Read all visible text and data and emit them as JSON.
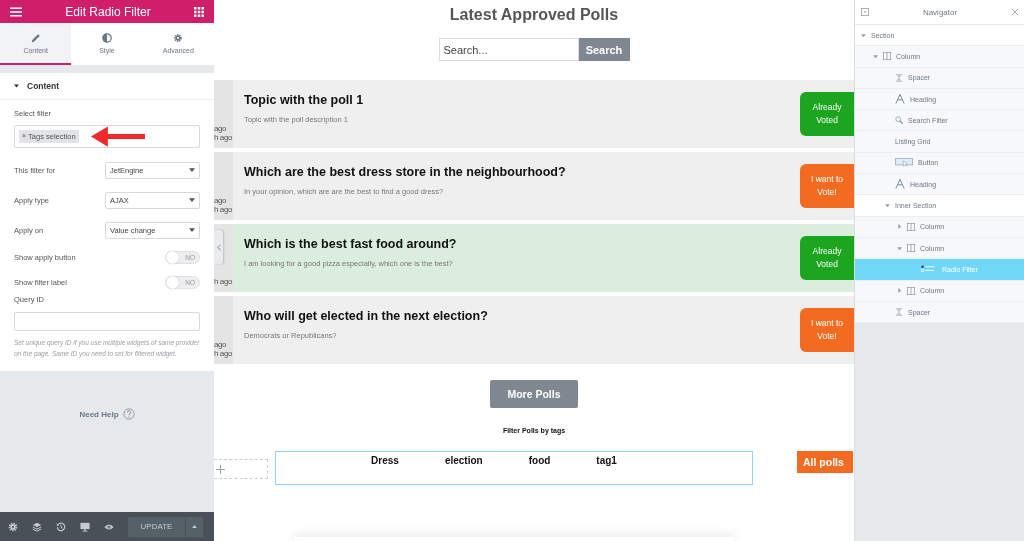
{
  "editor": {
    "title": "Edit Radio Filter",
    "tabs": [
      {
        "label": "Content",
        "selected": true
      },
      {
        "label": "Style",
        "selected": false
      },
      {
        "label": "Advanced",
        "selected": false
      }
    ],
    "section": {
      "title": "Content",
      "expanded": true
    },
    "select_filter": {
      "label": "Select filter",
      "tags": [
        {
          "remove": "×",
          "label": "Tags selection"
        }
      ]
    },
    "selects": [
      {
        "label": "This filter for",
        "value": "JetEngine"
      },
      {
        "label": "Apply type",
        "value": "AJAX"
      },
      {
        "label": "Apply on",
        "value": "Value change"
      }
    ],
    "toggles": [
      {
        "label": "Show apply button",
        "state": "NO",
        "on": false
      },
      {
        "label": "Show filter label",
        "state": "NO",
        "on": false
      }
    ],
    "query_id": {
      "label": "Query ID"
    },
    "hint": "Set unique query ID if you use multiple widgets of same provider on the page. Same ID you need to set for filtered widget.",
    "help": "Need Help",
    "update_button": "UPDATE"
  },
  "canvas": {
    "title": "Latest Approved Polls",
    "search": {
      "placeholder": "Search...",
      "button": "Search"
    },
    "polls": [
      {
        "title": "Topic with the poll 1",
        "description": "Topic with the poll description 1",
        "voted": true,
        "highlighted": false,
        "button": "Already Voted",
        "strip": [
          "ago",
          "h ago"
        ]
      },
      {
        "title": "Which are the best dress store in the neighbourhood?",
        "description": "In your opinion, which are are the best to find a good dress?",
        "voted": false,
        "highlighted": false,
        "button": "I want to Vote!",
        "strip": [
          "ago",
          "h ago"
        ]
      },
      {
        "title": "Which is the best fast food around?",
        "description": "I am looking for a good pizza especially, which one is the best?",
        "voted": true,
        "highlighted": true,
        "button": "Already Voted",
        "strip": [
          "h ago"
        ]
      },
      {
        "title": "Who will get elected in the next election?",
        "description": "Democrats or Republicans?",
        "voted": false,
        "highlighted": false,
        "button": "I want to Vote!",
        "strip": [
          "ago",
          "h ago"
        ]
      }
    ],
    "more_button": "More Polls",
    "filter_heading": "Filter Polls by tags",
    "tags": [
      "Dress",
      "election",
      "food",
      "tag1"
    ],
    "all_button": "All polls"
  },
  "navigator": {
    "title": "Navigator",
    "items": [
      {
        "label": "Section",
        "kind": "section",
        "expanded": true,
        "selected": false,
        "children": [
          {
            "label": "Column",
            "kind": "column",
            "expanded": true,
            "selected": false,
            "children": [
              {
                "label": "Spacer",
                "kind": "spacer",
                "selected": false
              },
              {
                "label": "Heading",
                "kind": "heading",
                "selected": false
              },
              {
                "label": "Search Filter",
                "kind": "search",
                "selected": false
              },
              {
                "label": "Listing Grid",
                "kind": "plain",
                "selected": false
              },
              {
                "label": "Button",
                "kind": "button",
                "selected": false
              },
              {
                "label": "Heading",
                "kind": "heading",
                "selected": false
              },
              {
                "label": "Inner Section",
                "kind": "section",
                "expanded": true,
                "selected": false,
                "children": [
                  {
                    "label": "Column",
                    "kind": "column",
                    "expanded": false,
                    "selected": false
                  },
                  {
                    "label": "Column",
                    "kind": "column",
                    "expanded": true,
                    "selected": false,
                    "children": [
                      {
                        "label": "Radio Filter",
                        "kind": "filter",
                        "selected": true
                      }
                    ]
                  },
                  {
                    "label": "Column",
                    "kind": "column",
                    "expanded": false,
                    "selected": false
                  }
                ]
              },
              {
                "label": "Spacer",
                "kind": "spacer",
                "selected": false
              }
            ]
          }
        ]
      }
    ]
  }
}
